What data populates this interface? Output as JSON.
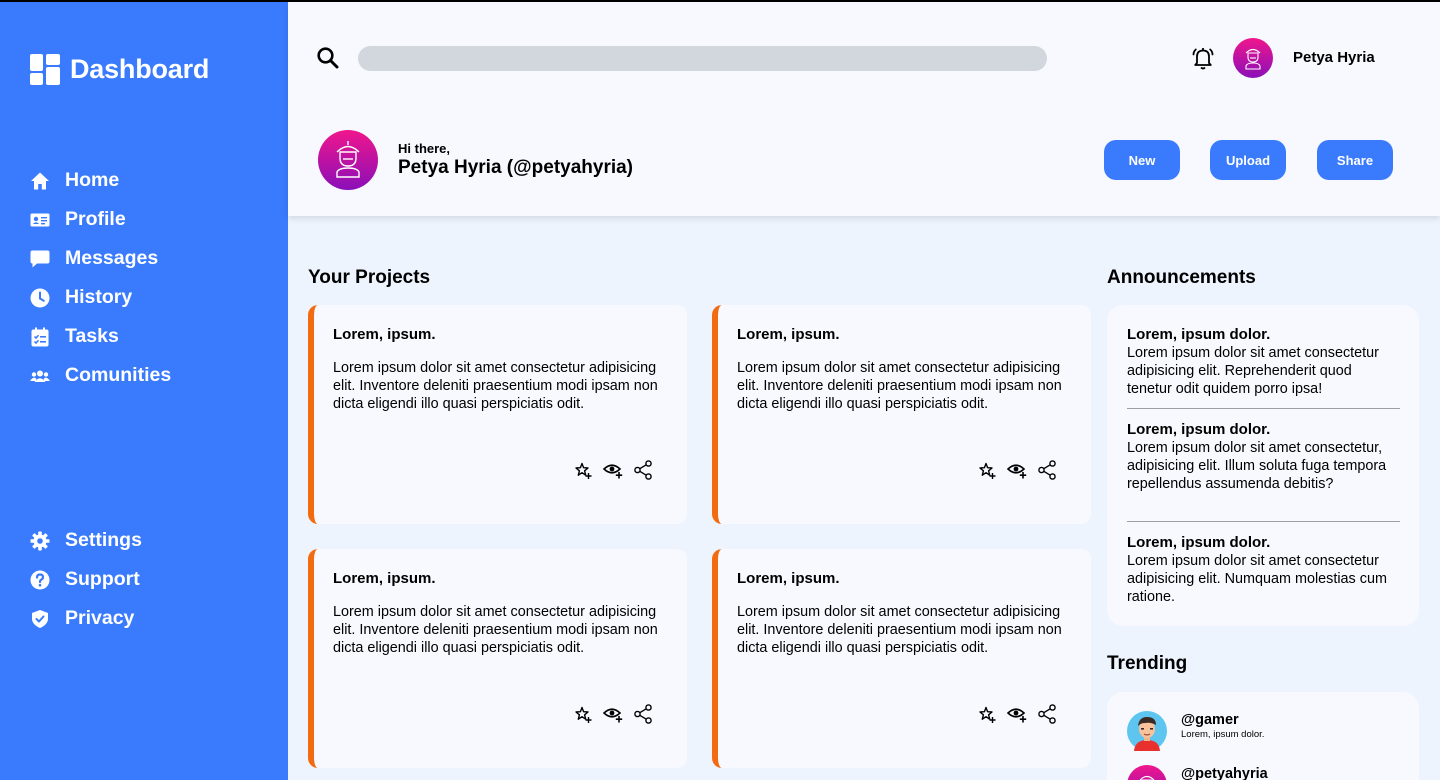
{
  "sidebar": {
    "brand": "Dashboard",
    "nav_top": [
      {
        "label": "Home",
        "icon": "home-icon"
      },
      {
        "label": "Profile",
        "icon": "id-card-icon"
      },
      {
        "label": "Messages",
        "icon": "message-icon"
      },
      {
        "label": "History",
        "icon": "clock-icon"
      },
      {
        "label": "Tasks",
        "icon": "tasks-icon"
      },
      {
        "label": "Comunities",
        "icon": "users-icon"
      }
    ],
    "nav_bottom": [
      {
        "label": "Settings",
        "icon": "gear-icon"
      },
      {
        "label": "Support",
        "icon": "help-icon"
      },
      {
        "label": "Privacy",
        "icon": "shield-icon"
      }
    ]
  },
  "header": {
    "search": {
      "placeholder": "",
      "value": ""
    },
    "user_name": "Petya Hyria",
    "greeting": "Hi there,",
    "full_name": "Petya Hyria (@petyahyria)",
    "buttons": {
      "new": "New",
      "upload": "Upload",
      "share": "Share"
    }
  },
  "projects": {
    "title": "Your Projects",
    "cards": [
      {
        "title": "Lorem, ipsum.",
        "body": "Lorem ipsum dolor sit amet consectetur adipisicing elit. Inventore deleniti praesentium modi ipsam non dicta eligendi illo quasi perspiciatis odit."
      },
      {
        "title": "Lorem, ipsum.",
        "body": "Lorem ipsum dolor sit amet consectetur adipisicing elit. Inventore deleniti praesentium modi ipsam non dicta eligendi illo quasi perspiciatis odit."
      },
      {
        "title": "Lorem, ipsum.",
        "body": "Lorem ipsum dolor sit amet consectetur adipisicing elit. Inventore deleniti praesentium modi ipsam non dicta eligendi illo quasi perspiciatis odit."
      },
      {
        "title": "Lorem, ipsum.",
        "body": "Lorem ipsum dolor sit amet consectetur adipisicing elit. Inventore deleniti praesentium modi ipsam non dicta eligendi illo quasi perspiciatis odit."
      }
    ]
  },
  "announcements": {
    "title": "Announcements",
    "items": [
      {
        "title": "Lorem, ipsum dolor.",
        "body": "Lorem ipsum dolor sit amet consectetur adipisicing elit. Reprehenderit quod tenetur odit quidem porro ipsa!"
      },
      {
        "title": "Lorem, ipsum dolor.",
        "body": "Lorem ipsum dolor sit amet consectetur, adipisicing elit. Illum soluta fuga tempora repellendus assumenda debitis?"
      },
      {
        "title": "Lorem, ipsum dolor.",
        "body": "Lorem ipsum dolor sit amet consectetur adipisicing elit. Numquam molestias cum ratione."
      }
    ]
  },
  "trending": {
    "title": "Trending",
    "items": [
      {
        "handle": "@gamer",
        "text": "Lorem, ipsum dolor.",
        "avatar": "gamer-avatar"
      },
      {
        "handle": "@petyahyria",
        "text": "",
        "avatar": "user-avatar"
      }
    ]
  },
  "colors": {
    "sidebar": "#3a7bfd",
    "accent": "#3a7bfd",
    "card_border": "#f36b10",
    "avatar_gradient": [
      "#f0168c",
      "#8a0fb8"
    ]
  }
}
